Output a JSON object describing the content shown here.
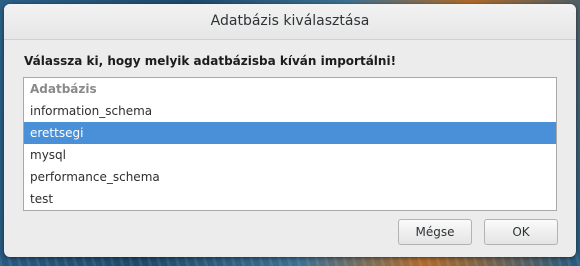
{
  "dialog": {
    "title": "Adatbázis kiválasztása",
    "prompt": "Válassza ki, hogy melyik adatbázisba kíván importálni!"
  },
  "list": {
    "header": "Adatbázis",
    "items": [
      {
        "label": "information_schema",
        "selected": false
      },
      {
        "label": "erettsegi",
        "selected": true
      },
      {
        "label": "mysql",
        "selected": false
      },
      {
        "label": "performance_schema",
        "selected": false
      },
      {
        "label": "test",
        "selected": false
      }
    ]
  },
  "buttons": {
    "cancel_label": "Mégse",
    "ok_label": "OK"
  },
  "colors": {
    "selection": "#4a90d9"
  }
}
